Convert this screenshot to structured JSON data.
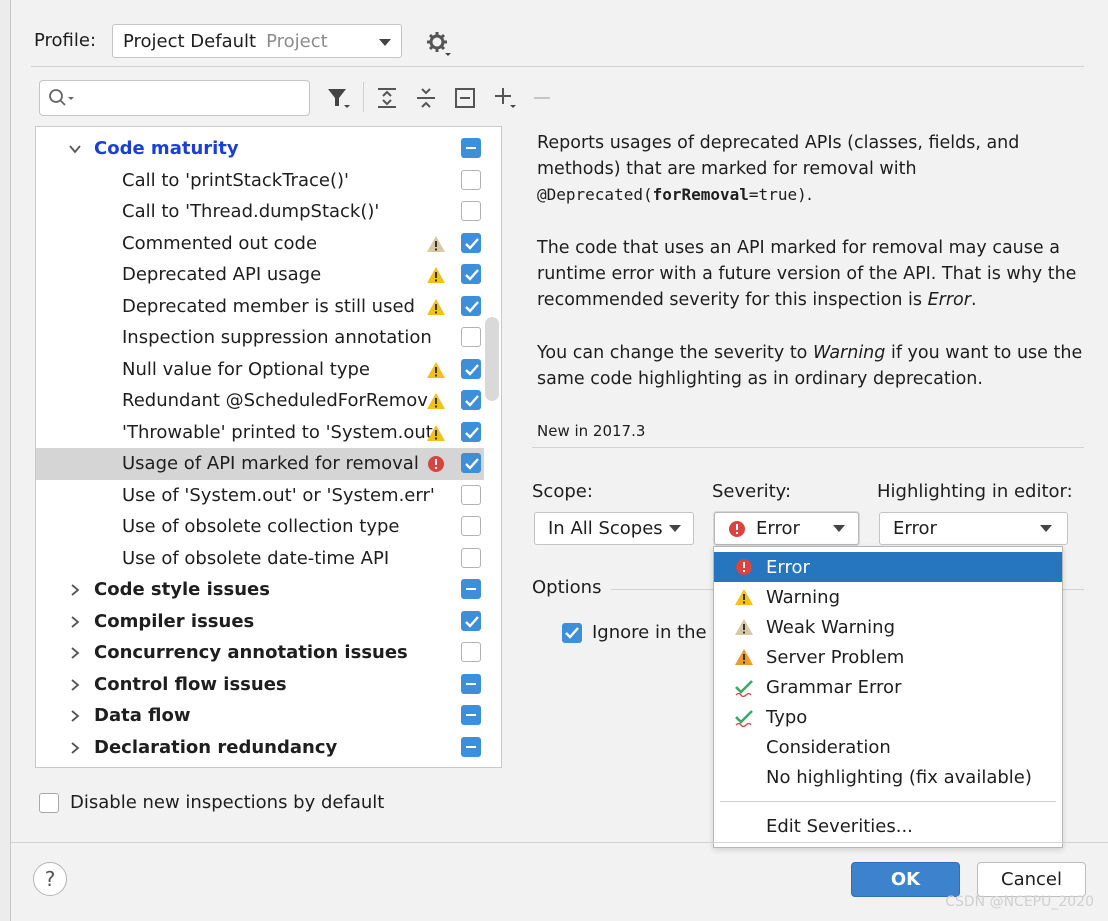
{
  "profile": {
    "label": "Profile:",
    "value": "Project Default",
    "scope_hint": "Project"
  },
  "toolbar": {
    "icons": [
      "filter-icon",
      "expand-all-icon",
      "collapse-all-icon",
      "reset-icon",
      "add-icon",
      "remove-icon"
    ]
  },
  "tree": {
    "category": "Code maturity",
    "children": [
      {
        "label": "Call to 'printStackTrace()'",
        "severity": "none",
        "checked": false
      },
      {
        "label": "Call to 'Thread.dumpStack()'",
        "severity": "none",
        "checked": false
      },
      {
        "label": "Commented out code",
        "severity": "weak-warning",
        "checked": true
      },
      {
        "label": "Deprecated API usage",
        "severity": "warning",
        "checked": true
      },
      {
        "label": "Deprecated member is still used",
        "severity": "warning",
        "checked": true
      },
      {
        "label": "Inspection suppression annotation",
        "severity": "none",
        "checked": false
      },
      {
        "label": "Null value for Optional type",
        "severity": "warning",
        "checked": true
      },
      {
        "label": "Redundant @ScheduledForRemov",
        "severity": "warning",
        "checked": true
      },
      {
        "label": "'Throwable' printed to 'System.out",
        "severity": "warning",
        "checked": true
      },
      {
        "label": "Usage of API marked for removal",
        "severity": "error",
        "checked": true,
        "selected": true
      },
      {
        "label": "Use of 'System.out' or 'System.err'",
        "severity": "none",
        "checked": false
      },
      {
        "label": "Use of obsolete collection type",
        "severity": "none",
        "checked": false
      },
      {
        "label": "Use of obsolete date-time API",
        "severity": "none",
        "checked": false
      }
    ],
    "categories": [
      {
        "label": "Code style issues",
        "state": "mixed"
      },
      {
        "label": "Compiler issues",
        "state": "checked"
      },
      {
        "label": "Concurrency annotation issues",
        "state": "unchecked"
      },
      {
        "label": "Control flow issues",
        "state": "mixed"
      },
      {
        "label": "Data flow",
        "state": "mixed"
      },
      {
        "label": "Declaration redundancy",
        "state": "mixed"
      }
    ]
  },
  "disable_new": "Disable new inspections by default",
  "description": {
    "p1_a": "Reports usages of deprecated APIs (classes, fields, and methods) that are marked for removal with",
    "p1_code_a": "@Deprecated(",
    "p1_code_b": "forRemoval",
    "p1_code_c": "=true)",
    "p1_end": ".",
    "p2_a": "The code that uses an API marked for removal may cause a runtime error with a future version of the API. That is why the recommended severity for this inspection is",
    "p2_em": "Error",
    "p2_end": ".",
    "p3_a": "You can change the severity to",
    "p3_em": "Warning",
    "p3_b": "if you want to use the same code highlighting as in ordinary deprecation.",
    "since": "New in 2017.3"
  },
  "scope": {
    "label": "Scope:",
    "value": "In All Scopes"
  },
  "severity": {
    "label": "Severity:",
    "value": "Error"
  },
  "highlighting": {
    "label": "Highlighting in editor:",
    "value": "Error"
  },
  "options": {
    "label": "Options",
    "ignore": "Ignore in the s"
  },
  "dropdown": {
    "items": [
      {
        "label": "Error",
        "icon": "error-icon",
        "selected": true
      },
      {
        "label": "Warning",
        "icon": "warning-icon"
      },
      {
        "label": "Weak Warning",
        "icon": "weak-warning-icon"
      },
      {
        "label": "Server Problem",
        "icon": "server-problem-icon"
      },
      {
        "label": "Grammar Error",
        "icon": "grammar-error-icon"
      },
      {
        "label": "Typo",
        "icon": "typo-icon"
      },
      {
        "label": "Consideration",
        "icon": ""
      },
      {
        "label": "No highlighting (fix available)",
        "icon": ""
      }
    ],
    "edit": "Edit Severities..."
  },
  "buttons": {
    "help": "?",
    "ok": "OK",
    "cancel": "Cancel"
  },
  "watermark": "CSDN @NCEPU_2020",
  "colors": {
    "accent": "#3c8fd8",
    "selection": "#2675bf",
    "error": "#d8453f",
    "warning": "#f2c21b",
    "weak_warning": "#d7c9a6",
    "category_blue": "#1b3fd6"
  }
}
